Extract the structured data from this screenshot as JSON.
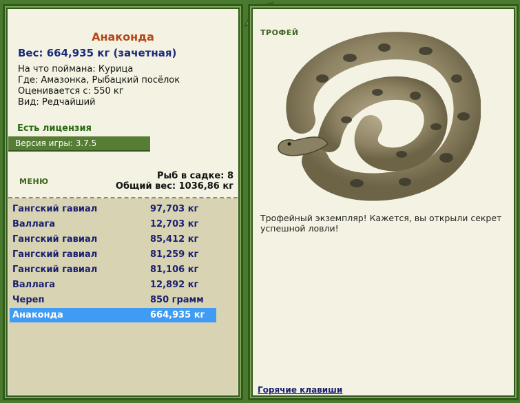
{
  "fish": {
    "name": "Анаконда",
    "weight_line": "Вес: 664,935 кг (зачетная)",
    "bait": "На что поймана: Курица",
    "location": "Где: Амазонка, Рыбацкий посёлок",
    "value": "Оценивается с: 550 кг",
    "kind": "Вид: Редчайший"
  },
  "license": "Есть лицензия",
  "version": "Версия игры: 3.7.5",
  "menu_label": "МЕНЮ",
  "stats": {
    "count": "Рыб в садке: 8",
    "total": "Общий вес: 1036,86 кг"
  },
  "catches": [
    {
      "name": "Гангский гавиал",
      "weight": "97,703 кг"
    },
    {
      "name": "Валлага",
      "weight": "12,703 кг"
    },
    {
      "name": "Гангский гавиал",
      "weight": "85,412 кг"
    },
    {
      "name": "Гангский гавиал",
      "weight": "81,259 кг"
    },
    {
      "name": "Гангский гавиал",
      "weight": "81,106 кг"
    },
    {
      "name": "Валлага",
      "weight": "12,892 кг"
    },
    {
      "name": "Череп",
      "weight": "850 грамм"
    },
    {
      "name": "Анаконда",
      "weight": "664,935 кг"
    }
  ],
  "selected_index": 7,
  "trophy_label": "ТРОФЕЙ",
  "trophy_text": "Трофейный экземпляр! Кажется, вы открыли секрет успешной ловли!",
  "hotkeys": "Горячие клавиши",
  "colors": {
    "accent_green": "#567d34",
    "selected": "#3f9bf3",
    "fish_name": "#b4471b",
    "weight_text": "#1a2a7a"
  }
}
